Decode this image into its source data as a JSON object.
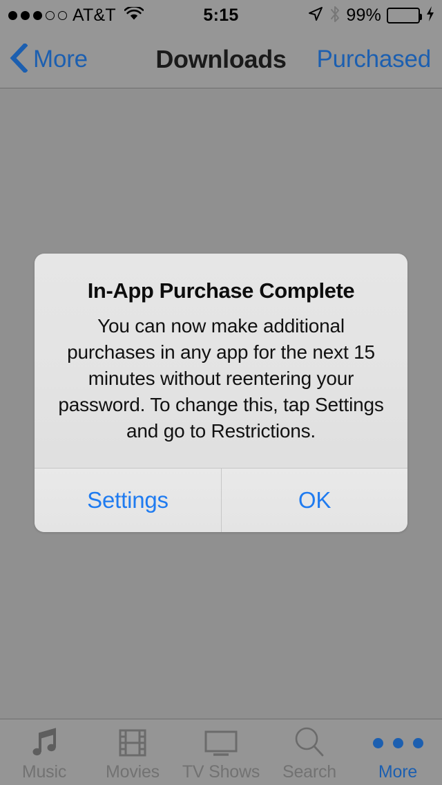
{
  "status_bar": {
    "signal_dots_filled": 3,
    "signal_dots_total": 5,
    "carrier": "AT&T",
    "wifi_icon": "wifi-icon",
    "time": "5:15",
    "location_icon": "location-arrow-icon",
    "bluetooth_icon": "bluetooth-icon",
    "battery_percent": "99%",
    "battery_level": 99,
    "battery_color": "#2aa13a",
    "charging": true
  },
  "nav_bar": {
    "back_icon": "chevron-left-icon",
    "back_label": "More",
    "title": "Downloads",
    "right_label": "Purchased",
    "tint_color": "#1c5fb0"
  },
  "alert": {
    "title": "In-App Purchase Complete",
    "message": "You can now make additional purchases in any app for the next 15 minutes without reentering your password. To change this, tap Settings and go to Restrictions.",
    "buttons": [
      {
        "label": "Settings"
      },
      {
        "label": "OK"
      }
    ],
    "button_color": "#1f7bf0",
    "background_color": "#e3e3e3"
  },
  "tab_bar": {
    "active_index": 4,
    "active_color": "#1c5fb0",
    "inactive_color": "#727272",
    "items": [
      {
        "label": "Music",
        "icon": "music-note-icon"
      },
      {
        "label": "Movies",
        "icon": "film-strip-icon"
      },
      {
        "label": "TV Shows",
        "icon": "television-icon"
      },
      {
        "label": "Search",
        "icon": "magnifier-icon"
      },
      {
        "label": "More",
        "icon": "ellipsis-icon"
      }
    ]
  }
}
